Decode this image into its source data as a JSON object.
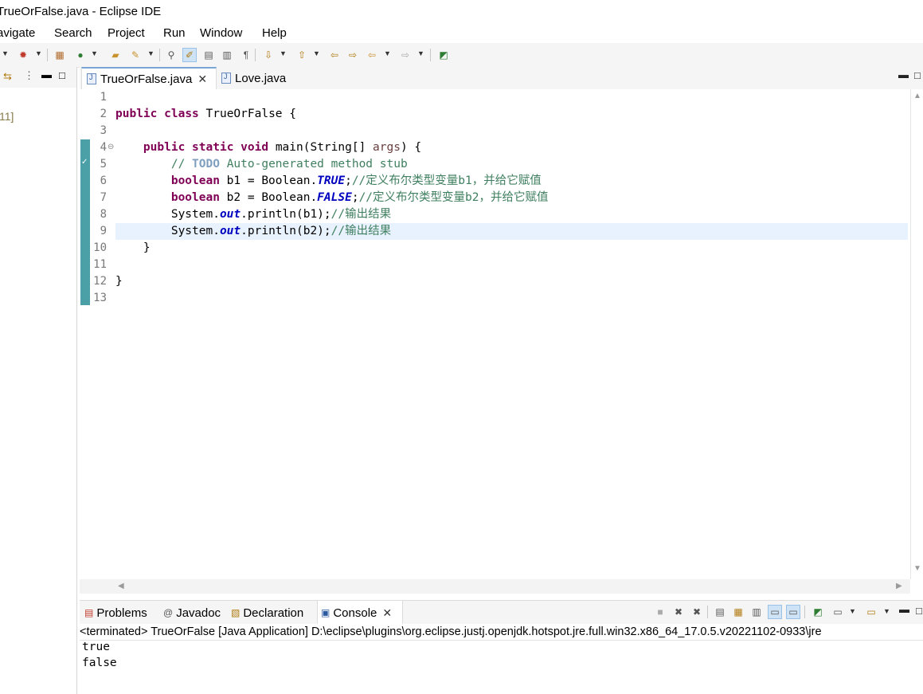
{
  "window": {
    "title": "TrueOrFalse.java - Eclipse IDE"
  },
  "menu": [
    "avigate",
    "Search",
    "Project",
    "Run",
    "Window",
    "Help"
  ],
  "left_view": {
    "item": "11]"
  },
  "editor": {
    "tabs": [
      {
        "label": "TrueOrFalse.java",
        "active": true
      },
      {
        "label": "Love.java",
        "active": false
      }
    ],
    "line_numbers": [
      "1",
      "2",
      "3",
      "4",
      "5",
      "6",
      "7",
      "8",
      "9",
      "10",
      "11",
      "12",
      "13"
    ],
    "lines": {
      "l2": {
        "kw1": "public",
        "kw2": "class",
        "rest": " TrueOrFalse {"
      },
      "l4": {
        "indent": "    ",
        "kw1": "public",
        "kw2": "static",
        "kw3": "void",
        "rest": " main(String[] ",
        "param": "args",
        "tail": ") {"
      },
      "l5": {
        "indent": "        ",
        "c1": "// ",
        "todo": "TODO",
        "c2": " Auto-generated method stub"
      },
      "l6": {
        "indent": "        ",
        "kw": "boolean",
        "mid": " b1 = Boolean.",
        "field": "TRUE",
        "semi": ";",
        "comment": "//定义布尔类型变量b1，并给它赋值"
      },
      "l7": {
        "indent": "        ",
        "kw": "boolean",
        "mid": " b2 = Boolean.",
        "field": "FALSE",
        "semi": ";",
        "comment": "//定义布尔类型变量b2，并给它赋值"
      },
      "l8": {
        "indent": "        ",
        "pre": "System.",
        "field": "out",
        "post": ".println(b1);",
        "comment": "//输出结果"
      },
      "l9": {
        "indent": "        ",
        "pre": "System.",
        "field": "out",
        "post": ".println(b2);",
        "comment": "//输出结果"
      },
      "l10": {
        "text": "    }"
      },
      "l12": {
        "text": "}"
      }
    }
  },
  "console": {
    "tabs": [
      {
        "label": "Problems",
        "icon": "problems-icon"
      },
      {
        "label": "Javadoc",
        "icon": "at-icon"
      },
      {
        "label": "Declaration",
        "icon": "declaration-icon"
      },
      {
        "label": "Console",
        "icon": "console-icon",
        "active": true
      }
    ],
    "status": "<terminated> TrueOrFalse [Java Application] D:\\eclipse\\plugins\\org.eclipse.justj.openjdk.hotspot.jre.full.win32.x86_64_17.0.5.v20221102-0933\\jre",
    "output": [
      "true",
      "false"
    ]
  },
  "colors": {
    "keyword": "#7f0055",
    "comment": "#3f7f5f",
    "field": "#0000c0",
    "current_line": "#e8f2fe",
    "ruler": "#4ba0a8"
  }
}
